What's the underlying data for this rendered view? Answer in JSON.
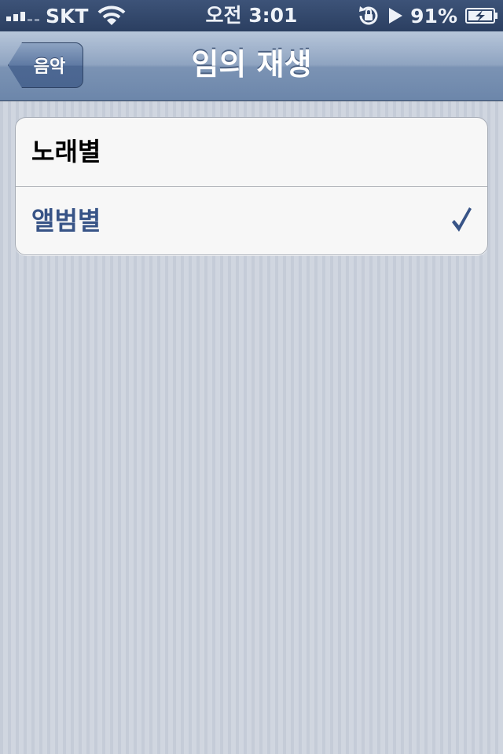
{
  "status_bar": {
    "carrier": "SKT",
    "time": "오전 3:01",
    "battery_percent": "91%",
    "icons": [
      "signal-icon",
      "wifi-icon",
      "rotation-lock-icon",
      "play-icon",
      "battery-charging-icon"
    ]
  },
  "nav": {
    "back_label": "음악",
    "title": "임의 재생"
  },
  "options": [
    {
      "label": "노래별",
      "selected": false
    },
    {
      "label": "앨범별",
      "selected": true
    }
  ],
  "colors": {
    "nav_bar": "#7b93b4",
    "selected_text": "#385487",
    "background": "#cbd2dd"
  }
}
